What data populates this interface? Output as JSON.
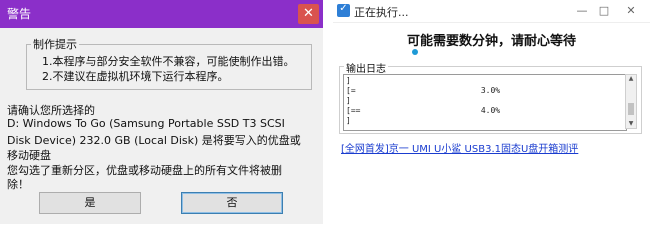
{
  "warning_dialog": {
    "title": "警告",
    "close_symbol": "✕",
    "hint_group_title": "制作提示",
    "hints": [
      "1.本程序与部分安全软件不兼容，可能使制作出错。",
      "2.不建议在虚拟机环境下运行本程序。"
    ],
    "message_lines": [
      "请确认您所选择的",
      "D: Windows To Go (Samsung Portable SSD T3 SCSI",
      "Disk Device) 232.0 GB (Local Disk) 是将要写入的优盘或",
      "移动硬盘",
      "您勾选了重新分区，优盘或移动硬盘上的所有文件将被删",
      "除！"
    ],
    "yes_label": "是",
    "no_label": "否"
  },
  "progress_dialog": {
    "title": "正在执行...",
    "app_icon_glyph": "✓",
    "minimize_symbol": "—",
    "maximize_symbol": "□",
    "close_symbol": "✕",
    "wait_message": "可能需要数分钟，请耐心等待",
    "log_group_title": "输出日志",
    "log_lines": [
      "]",
      "[=                          3.0%",
      "]",
      "[==                         4.0%",
      "]"
    ],
    "footer_link": "[全网首发]京一 UMI U小鲨 USB3.1固态U盘开箱测评"
  },
  "icons": {
    "warning_close": "close-icon",
    "progress_app": "app-icon",
    "minimize": "minimize-icon",
    "maximize": "maximize-icon",
    "progress_close": "close-icon",
    "spinner": "spinner-icon",
    "scroll_up": "scroll-up-icon",
    "scroll_down": "scroll-down-icon"
  },
  "colors": {
    "warning_titlebar": "#8b2fc9",
    "close_button": "#d9534f",
    "spinner": "#1e9ad6",
    "link": "#1a3ccf"
  }
}
